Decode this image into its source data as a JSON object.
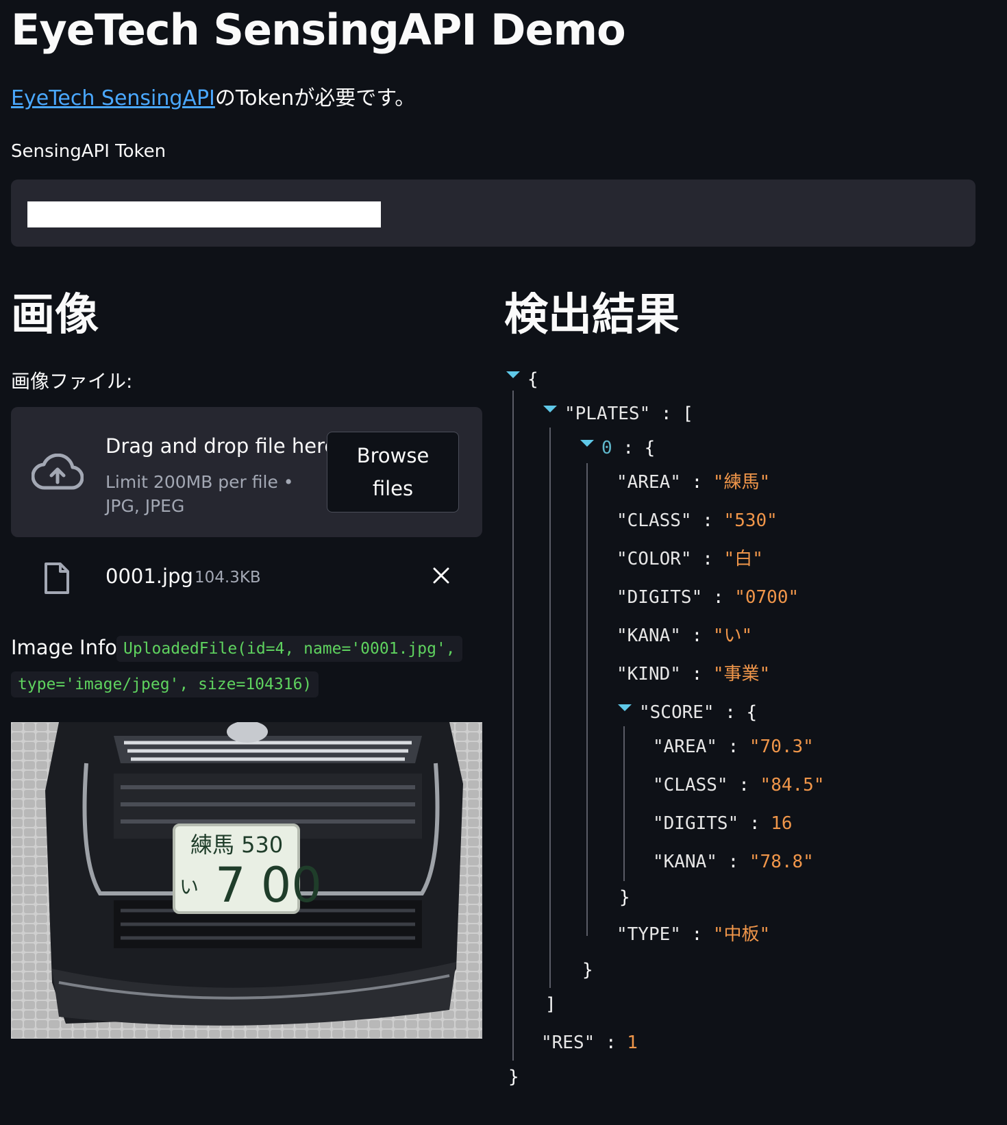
{
  "page": {
    "title": "EyeTech SensingAPI Demo",
    "intro_link": "EyeTech SensingAPI",
    "intro_rest": "のTokenが必要です。"
  },
  "token": {
    "label": "SensingAPI Token",
    "value": ""
  },
  "image_section": {
    "heading": "画像",
    "file_label": "画像ファイル:",
    "dropzone": {
      "title": "Drag and drop file here",
      "limit": "Limit 200MB per file • JPG, JPEG",
      "browse_line1": "Browse",
      "browse_line2": "files"
    },
    "uploaded_file": {
      "name": "0001.jpg",
      "size": "104.3KB"
    },
    "info_label": "Image Info:",
    "info_line1": "UploadedFile(id=4, name='0001.jpg',",
    "info_line2": "type='image/jpeg', size=104316)",
    "plate": {
      "top": "練馬 530",
      "kana": "い",
      "digits": "7 00"
    }
  },
  "result_section": {
    "heading": "検出結果",
    "json": {
      "open_brace": "{",
      "plates_key": "\"PLATES\"",
      "open_bracket": "[",
      "index": "0",
      "sep": ":",
      "area_key": "\"AREA\"",
      "area_val": "\"練馬\"",
      "class_key": "\"CLASS\"",
      "class_val": "\"530\"",
      "color_key": "\"COLOR\"",
      "color_val": "\"白\"",
      "digits_key": "\"DIGITS\"",
      "digits_val": "\"0700\"",
      "kana_key": "\"KANA\"",
      "kana_val": "\"い\"",
      "kind_key": "\"KIND\"",
      "kind_val": "\"事業\"",
      "score_key": "\"SCORE\"",
      "score_area_key": "\"AREA\"",
      "score_area_val": "\"70.3\"",
      "score_class_key": "\"CLASS\"",
      "score_class_val": "\"84.5\"",
      "score_digits_key": "\"DIGITS\"",
      "score_digits_val": "16",
      "score_kana_key": "\"KANA\"",
      "score_kana_val": "\"78.8\"",
      "close_brace": "}",
      "type_key": "\"TYPE\"",
      "type_val": "\"中板\"",
      "close_bracket": "]",
      "res_key": "\"RES\"",
      "res_val": "1"
    }
  },
  "colors": {
    "background": "#0e1117",
    "panel": "#262730",
    "link": "#4aa8ff",
    "json_string": "#f0964a",
    "code_green": "#5fd35f"
  }
}
